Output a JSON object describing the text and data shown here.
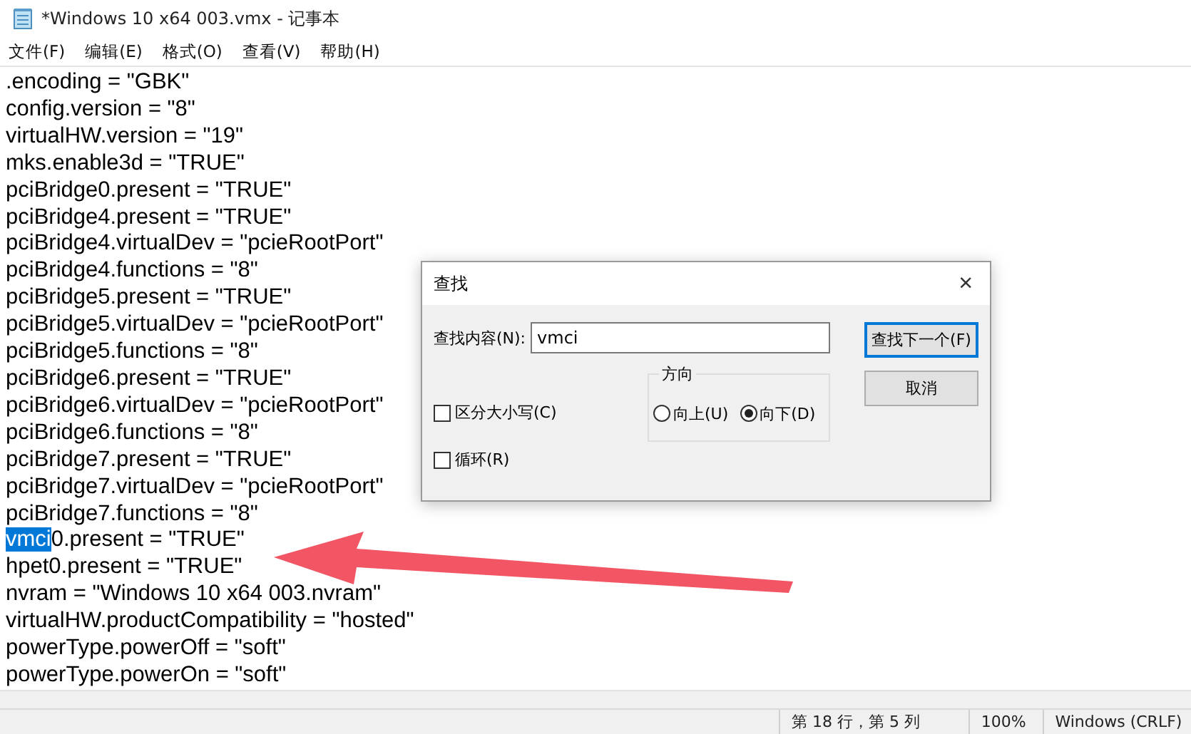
{
  "window": {
    "title": "*Windows 10 x64 003.vmx - 记事本"
  },
  "menu": [
    "文件(F)",
    "编辑(E)",
    "格式(O)",
    "查看(V)",
    "帮助(H)"
  ],
  "lines": [
    ".encoding = \"GBK\"",
    "config.version = \"8\"",
    "virtualHW.version = \"19\"",
    "mks.enable3d = \"TRUE\"",
    "pciBridge0.present = \"TRUE\"",
    "pciBridge4.present = \"TRUE\"",
    "pciBridge4.virtualDev = \"pcieRootPort\"",
    "pciBridge4.functions = \"8\"",
    "pciBridge5.present = \"TRUE\"",
    "pciBridge5.virtualDev = \"pcieRootPort\"",
    "pciBridge5.functions = \"8\"",
    "pciBridge6.present = \"TRUE\"",
    "pciBridge6.virtualDev = \"pcieRootPort\"",
    "pciBridge6.functions = \"8\"",
    "pciBridge7.present = \"TRUE\"",
    "pciBridge7.virtualDev = \"pcieRootPort\"",
    "pciBridge7.functions = \"8\"",
    {
      "selection": "vmci",
      "rest": "0.present = \"TRUE\""
    },
    "hpet0.present = \"TRUE\"",
    "nvram = \"Windows 10 x64 003.nvram\"",
    "virtualHW.productCompatibility = \"hosted\"",
    "powerType.powerOff = \"soft\"",
    "powerType.powerOn = \"soft\""
  ],
  "find_dialog": {
    "title": "查找",
    "close": "×",
    "find_label": "查找内容(N):",
    "find_value": "vmci",
    "find_next": "查找下一个(F)",
    "cancel": "取消",
    "direction_label": "方向",
    "directions": [
      {
        "label": "向上(U)",
        "selected": false
      },
      {
        "label": "向下(D)",
        "selected": true
      }
    ],
    "options": [
      {
        "label": "区分大小写(C)",
        "checked": false
      },
      {
        "label": "循环(R)",
        "checked": false
      }
    ]
  },
  "status_bar": [
    "第 18 行，第 5 列",
    "100%",
    "Windows (CRLF)"
  ]
}
